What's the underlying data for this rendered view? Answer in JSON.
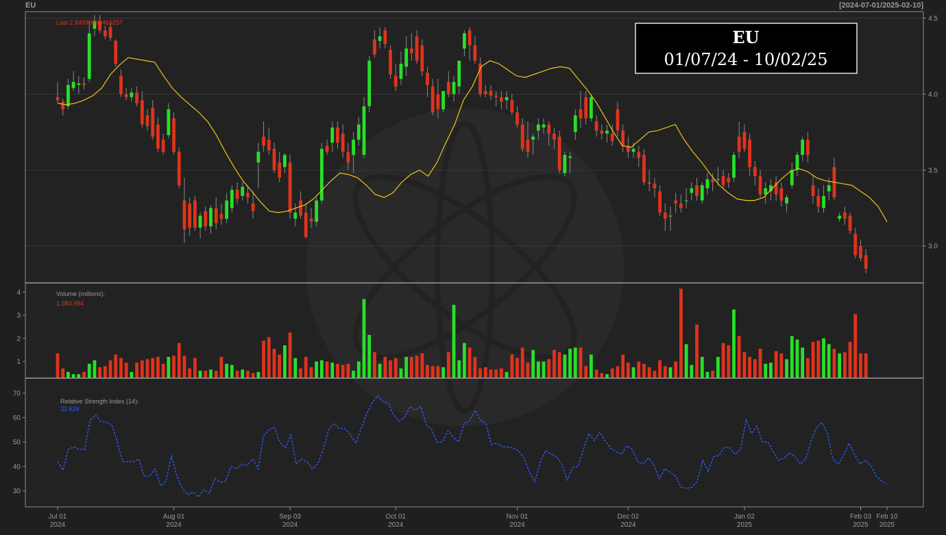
{
  "header": {
    "symbol": "EU",
    "range": "[2024-07-01/2025-02-10]"
  },
  "title_box": {
    "line1": "EU",
    "line2": "01/07/24 - 10/02/25"
  },
  "colors": {
    "background": "#222222",
    "up": "#27e027",
    "down": "#e0331c",
    "ma": "#f0c419",
    "rsi": "#2f5bff",
    "axis_text": "#9a9a9a",
    "frame": "#8c8c8c"
  },
  "chart_data": {
    "type": "candlestick",
    "price_panel": {
      "last_label": "Last 2.84999990463257",
      "ylim": [
        2.78,
        4.52
      ],
      "yticks": [
        3.0,
        3.5,
        4.0,
        4.5
      ],
      "ytick_labels": [
        "3.0",
        "3.5",
        "4.0",
        "4.5"
      ],
      "ma_line": [
        3.94,
        3.93,
        3.94,
        3.96,
        3.99,
        4.04,
        4.13,
        4.19,
        4.24,
        4.23,
        4.22,
        4.21,
        4.12,
        4.04,
        3.98,
        3.93,
        3.88,
        3.82,
        3.73,
        3.62,
        3.52,
        3.43,
        3.36,
        3.29,
        3.23,
        3.22,
        3.23,
        3.25,
        3.27,
        3.31,
        3.37,
        3.43,
        3.48,
        3.47,
        3.45,
        3.4,
        3.34,
        3.32,
        3.35,
        3.42,
        3.47,
        3.5,
        3.46,
        3.55,
        3.68,
        3.8,
        3.96,
        4.05,
        4.18,
        4.22,
        4.2,
        4.16,
        4.12,
        4.11,
        4.13,
        4.15,
        4.17,
        4.18,
        4.17,
        4.1,
        4.03,
        3.95,
        3.85,
        3.75,
        3.66,
        3.65,
        3.7,
        3.75,
        3.76,
        3.78,
        3.8,
        3.7,
        3.62,
        3.55,
        3.47,
        3.4,
        3.35,
        3.31,
        3.3,
        3.3,
        3.32,
        3.38,
        3.44,
        3.49,
        3.51,
        3.49,
        3.45,
        3.43,
        3.42,
        3.41,
        3.4,
        3.36,
        3.32,
        3.26,
        3.16
      ]
    },
    "volume_panel": {
      "label": "Volume (millions):",
      "value_label": "1.383.994",
      "ylim": [
        0.28,
        4.25
      ],
      "yticks": [
        1,
        2,
        3,
        4
      ],
      "ytick_labels": [
        "1",
        "2",
        "3",
        "4"
      ]
    },
    "rsi_panel": {
      "label": "Relative Strength Index (14):",
      "value_label": "32.626",
      "ylim": [
        24,
        75
      ],
      "yticks": [
        30,
        40,
        50,
        60,
        70
      ],
      "ytick_labels": [
        "30",
        "40",
        "50",
        "60",
        "70"
      ],
      "values": [
        42,
        38.5,
        47,
        48,
        47,
        47,
        59,
        61,
        58.5,
        58,
        57,
        50,
        42,
        42,
        42,
        43,
        36,
        36,
        39,
        32,
        34,
        44.5,
        36,
        31,
        28.5,
        29.5,
        27.5,
        30.5,
        29,
        35,
        33.5,
        34,
        40,
        39,
        41,
        40.5,
        43,
        39,
        52.5,
        55,
        56,
        50,
        47.5,
        53,
        41,
        43,
        42,
        39,
        41,
        47,
        55,
        57.5,
        55.5,
        55.5,
        53,
        49.5,
        55.5,
        61.5,
        66,
        69,
        66.5,
        66,
        61,
        58.5,
        60,
        64.5,
        63,
        64.5,
        57,
        55,
        50,
        50,
        54.5,
        52,
        50,
        57.5,
        58.5,
        63,
        59,
        57.5,
        49,
        49.5,
        48,
        48,
        47.5,
        46.5,
        43.5,
        38,
        33.5,
        41.5,
        46.5,
        45,
        44,
        41,
        34.5,
        39.5,
        40,
        47,
        53.5,
        50.5,
        54,
        50.5,
        47.5,
        46,
        45,
        48.5,
        47,
        42,
        41,
        43.5,
        40.5,
        35,
        39,
        37.5,
        36,
        31.5,
        31,
        31.5,
        34,
        42.5,
        38,
        44,
        44.5,
        48,
        47.5,
        45,
        47,
        59,
        53.5,
        56.5,
        50,
        50,
        46,
        42.5,
        43.5,
        45.5,
        44,
        41,
        43,
        50.5,
        56,
        58,
        53.5,
        43,
        41,
        44.5,
        49.5,
        45,
        41,
        42.5,
        40.5,
        36,
        34,
        32.6
      ]
    },
    "x_axis": {
      "ticks": [
        {
          "index": 0,
          "line1": "Jul 01",
          "line2": "2024"
        },
        {
          "index": 22,
          "line1": "Aug 01",
          "line2": "2024"
        },
        {
          "index": 44,
          "line1": "Sep 03",
          "line2": "2024"
        },
        {
          "index": 64,
          "line1": "Oct 01",
          "line2": "2024"
        },
        {
          "index": 87,
          "line1": "Nov 01",
          "line2": "2024"
        },
        {
          "index": 108,
          "line1": "Dec 02",
          "line2": "2024"
        },
        {
          "index": 130,
          "line1": "Jan 02",
          "line2": "2025"
        },
        {
          "index": 152,
          "line1": "Feb 03",
          "line2": "2025"
        },
        {
          "index": 157,
          "line1": "Feb 10",
          "line2": "2025"
        }
      ],
      "count": 158
    },
    "candles": [
      [
        3.98,
        4.08,
        3.94,
        3.96,
        1.35
      ],
      [
        3.95,
        3.97,
        3.86,
        3.9,
        0.7
      ],
      [
        3.92,
        4.1,
        3.9,
        4.06,
        0.55
      ],
      [
        4.04,
        4.15,
        4.02,
        4.08,
        0.45
      ],
      [
        4.06,
        4.12,
        4.0,
        4.07,
        0.45
      ],
      [
        4.07,
        4.11,
        4.03,
        4.06,
        0.55
      ],
      [
        4.1,
        4.48,
        4.08,
        4.4,
        0.9
      ],
      [
        4.43,
        4.52,
        4.38,
        4.48,
        1.05
      ],
      [
        4.48,
        4.52,
        4.4,
        4.42,
        0.75
      ],
      [
        4.42,
        4.45,
        4.36,
        4.38,
        0.8
      ],
      [
        4.44,
        4.47,
        4.35,
        4.37,
        1.05
      ],
      [
        4.35,
        4.36,
        4.18,
        4.2,
        1.3
      ],
      [
        4.12,
        4.16,
        3.98,
        4.0,
        1.15
      ],
      [
        4.0,
        4.04,
        3.96,
        3.98,
        0.95
      ],
      [
        3.98,
        4.04,
        3.95,
        4.01,
        0.55
      ],
      [
        4.01,
        4.05,
        3.92,
        3.94,
        0.95
      ],
      [
        3.96,
        4.02,
        3.78,
        3.8,
        1.05
      ],
      [
        3.86,
        3.9,
        3.76,
        3.79,
        1.1
      ],
      [
        3.91,
        3.96,
        3.7,
        3.72,
        1.15
      ],
      [
        3.8,
        3.85,
        3.62,
        3.64,
        1.2
      ],
      [
        3.7,
        3.74,
        3.6,
        3.62,
        0.9
      ],
      [
        3.73,
        3.94,
        3.71,
        3.9,
        1.2
      ],
      [
        3.84,
        3.88,
        3.6,
        3.62,
        1.25
      ],
      [
        3.62,
        3.65,
        3.38,
        3.4,
        1.8
      ],
      [
        3.3,
        3.45,
        3.02,
        3.11,
        1.25
      ],
      [
        3.28,
        3.32,
        3.07,
        3.12,
        0.7
      ],
      [
        3.3,
        3.33,
        3.1,
        3.12,
        1.15
      ],
      [
        3.12,
        3.22,
        3.05,
        3.2,
        0.6
      ],
      [
        3.23,
        3.26,
        3.1,
        3.13,
        0.6
      ],
      [
        3.13,
        3.27,
        3.08,
        3.25,
        0.65
      ],
      [
        3.25,
        3.32,
        3.11,
        3.15,
        0.6
      ],
      [
        3.21,
        3.28,
        3.14,
        3.18,
        1.2
      ],
      [
        3.18,
        3.35,
        3.15,
        3.3,
        0.9
      ],
      [
        3.25,
        3.4,
        3.22,
        3.37,
        0.85
      ],
      [
        3.37,
        3.42,
        3.28,
        3.31,
        0.6
      ],
      [
        3.33,
        3.42,
        3.3,
        3.39,
        0.65
      ],
      [
        3.35,
        3.4,
        3.28,
        3.32,
        0.6
      ],
      [
        3.28,
        3.36,
        3.18,
        3.23,
        0.5
      ],
      [
        3.55,
        3.68,
        3.38,
        3.62,
        0.55
      ],
      [
        3.72,
        3.82,
        3.62,
        3.66,
        1.9
      ],
      [
        3.7,
        3.78,
        3.6,
        3.63,
        2.05
      ],
      [
        3.64,
        3.68,
        3.48,
        3.5,
        1.55
      ],
      [
        3.55,
        3.62,
        3.42,
        3.45,
        1.3
      ],
      [
        3.52,
        3.61,
        3.48,
        3.6,
        1.7
      ],
      [
        3.55,
        3.6,
        3.18,
        3.22,
        2.25
      ],
      [
        3.18,
        3.28,
        3.13,
        3.22,
        1.15
      ],
      [
        3.3,
        3.36,
        3.18,
        3.2,
        0.7
      ],
      [
        3.22,
        3.28,
        3.05,
        3.06,
        1.2
      ],
      [
        3.18,
        3.25,
        3.12,
        3.16,
        0.75
      ],
      [
        3.16,
        3.32,
        3.13,
        3.3,
        1.0
      ],
      [
        3.3,
        3.68,
        3.28,
        3.64,
        1.05
      ],
      [
        3.66,
        3.7,
        3.6,
        3.62,
        1.0
      ],
      [
        3.68,
        3.82,
        3.62,
        3.78,
        0.95
      ],
      [
        3.78,
        3.82,
        3.64,
        3.68,
        0.9
      ],
      [
        3.74,
        3.8,
        3.58,
        3.62,
        0.85
      ],
      [
        3.62,
        3.68,
        3.5,
        3.55,
        0.9
      ],
      [
        3.6,
        3.75,
        3.48,
        3.7,
        0.6
      ],
      [
        3.7,
        3.85,
        3.66,
        3.8,
        1.0
      ],
      [
        3.6,
        3.98,
        3.58,
        3.92,
        3.7
      ],
      [
        3.92,
        4.25,
        3.88,
        4.22,
        2.15
      ],
      [
        4.36,
        4.42,
        4.24,
        4.26,
        1.4
      ],
      [
        4.35,
        4.44,
        4.3,
        4.38,
        0.9
      ],
      [
        4.42,
        4.44,
        4.3,
        4.33,
        1.2
      ],
      [
        4.29,
        4.32,
        4.1,
        4.13,
        1.05
      ],
      [
        4.12,
        4.2,
        4.02,
        4.05,
        1.15
      ],
      [
        4.1,
        4.28,
        4.06,
        4.2,
        0.7
      ],
      [
        4.18,
        4.38,
        4.12,
        4.3,
        1.2
      ],
      [
        4.3,
        4.4,
        4.22,
        4.27,
        1.2
      ],
      [
        4.38,
        4.42,
        4.2,
        4.22,
        1.25
      ],
      [
        4.32,
        4.36,
        4.12,
        4.15,
        1.35
      ],
      [
        4.14,
        4.18,
        3.98,
        4.06,
        0.85
      ],
      [
        4.05,
        4.1,
        3.86,
        3.88,
        0.8
      ],
      [
        4.0,
        4.1,
        3.84,
        3.9,
        0.8
      ],
      [
        3.9,
        4.02,
        3.88,
        4.02,
        0.75
      ],
      [
        4.08,
        4.15,
        3.98,
        4.0,
        1.4
      ],
      [
        4.0,
        4.12,
        3.95,
        4.08,
        3.45
      ],
      [
        4.05,
        4.22,
        4.0,
        4.22,
        1.05
      ],
      [
        4.3,
        4.42,
        4.25,
        4.4,
        1.8
      ],
      [
        4.42,
        4.44,
        4.22,
        4.32,
        1.6
      ],
      [
        4.32,
        4.38,
        4.2,
        4.22,
        1.2
      ],
      [
        4.2,
        4.24,
        3.98,
        4.0,
        0.7
      ],
      [
        4.02,
        4.06,
        3.98,
        4.0,
        0.75
      ],
      [
        4.02,
        4.06,
        3.96,
        3.99,
        0.65
      ],
      [
        3.99,
        4.02,
        3.92,
        3.98,
        0.65
      ],
      [
        3.98,
        4.02,
        3.9,
        3.95,
        0.7
      ],
      [
        3.96,
        4.02,
        3.9,
        3.98,
        0.55
      ],
      [
        3.96,
        4.0,
        3.86,
        3.88,
        1.3
      ],
      [
        3.88,
        3.92,
        3.78,
        3.8,
        1.15
      ],
      [
        3.8,
        3.84,
        3.62,
        3.64,
        1.6
      ],
      [
        3.7,
        3.82,
        3.58,
        3.62,
        0.95
      ],
      [
        3.7,
        3.74,
        3.6,
        3.72,
        1.5
      ],
      [
        3.76,
        3.84,
        3.7,
        3.8,
        1.0
      ],
      [
        3.78,
        3.84,
        3.74,
        3.8,
        1.0
      ],
      [
        3.8,
        3.82,
        3.66,
        3.74,
        1.1
      ],
      [
        3.74,
        3.78,
        3.64,
        3.7,
        1.5
      ],
      [
        3.72,
        3.76,
        3.48,
        3.5,
        1.4
      ],
      [
        3.48,
        3.62,
        3.46,
        3.6,
        1.3
      ],
      [
        3.58,
        3.62,
        3.48,
        3.59,
        1.55
      ],
      [
        3.75,
        3.9,
        3.7,
        3.86,
        1.6
      ],
      [
        3.9,
        4.02,
        3.78,
        3.84,
        1.6
      ],
      [
        3.98,
        4.02,
        3.8,
        3.84,
        0.8
      ],
      [
        3.84,
        4.0,
        3.82,
        3.98,
        1.3
      ],
      [
        3.82,
        3.86,
        3.72,
        3.76,
        0.65
      ],
      [
        3.76,
        3.8,
        3.7,
        3.74,
        0.5
      ],
      [
        3.74,
        3.8,
        3.68,
        3.76,
        0.45
      ],
      [
        3.74,
        3.8,
        3.66,
        3.69,
        0.7
      ],
      [
        3.9,
        3.95,
        3.72,
        3.76,
        0.8
      ],
      [
        3.76,
        3.8,
        3.62,
        3.66,
        1.3
      ],
      [
        3.66,
        3.72,
        3.58,
        3.62,
        0.95
      ],
      [
        3.62,
        3.68,
        3.58,
        3.64,
        0.75
      ],
      [
        3.62,
        3.66,
        3.52,
        3.58,
        1.0
      ],
      [
        3.6,
        3.64,
        3.4,
        3.42,
        0.9
      ],
      [
        3.42,
        3.5,
        3.36,
        3.41,
        0.75
      ],
      [
        3.41,
        3.45,
        3.32,
        3.38,
        0.6
      ],
      [
        3.36,
        3.4,
        3.2,
        3.22,
        1.05
      ],
      [
        3.22,
        3.28,
        3.1,
        3.18,
        0.8
      ],
      [
        3.2,
        3.26,
        3.1,
        3.2,
        0.75
      ],
      [
        3.3,
        3.35,
        3.22,
        3.28,
        1.0
      ],
      [
        3.28,
        3.34,
        3.22,
        3.25,
        4.15
      ],
      [
        3.3,
        3.38,
        3.25,
        3.3,
        1.75
      ],
      [
        3.35,
        3.42,
        3.3,
        3.38,
        0.85
      ],
      [
        3.4,
        3.45,
        3.3,
        3.33,
        2.6
      ],
      [
        3.3,
        3.42,
        3.28,
        3.4,
        1.2
      ],
      [
        3.38,
        3.48,
        3.34,
        3.44,
        0.55
      ],
      [
        3.44,
        3.48,
        3.36,
        3.42,
        0.6
      ],
      [
        3.44,
        3.52,
        3.4,
        3.44,
        1.2
      ],
      [
        3.46,
        3.5,
        3.38,
        3.4,
        1.8
      ],
      [
        3.45,
        3.48,
        3.38,
        3.42,
        1.7
      ],
      [
        3.45,
        3.62,
        3.42,
        3.6,
        3.25
      ],
      [
        3.72,
        3.82,
        3.58,
        3.62,
        2.1
      ],
      [
        3.75,
        3.8,
        3.62,
        3.64,
        1.4
      ],
      [
        3.7,
        3.74,
        3.46,
        3.52,
        1.2
      ],
      [
        3.52,
        3.56,
        3.4,
        3.46,
        1.1
      ],
      [
        3.46,
        3.5,
        3.32,
        3.34,
        1.55
      ],
      [
        3.34,
        3.42,
        3.28,
        3.38,
        0.9
      ],
      [
        3.36,
        3.44,
        3.3,
        3.4,
        0.95
      ],
      [
        3.42,
        3.46,
        3.3,
        3.34,
        1.45
      ],
      [
        3.38,
        3.42,
        3.26,
        3.3,
        1.35
      ],
      [
        3.28,
        3.34,
        3.22,
        3.32,
        1.1
      ],
      [
        3.4,
        3.55,
        3.38,
        3.5,
        2.1
      ],
      [
        3.5,
        3.62,
        3.46,
        3.6,
        1.95
      ],
      [
        3.6,
        3.72,
        3.56,
        3.7,
        1.6
      ],
      [
        3.7,
        3.75,
        3.55,
        3.6,
        1.15
      ],
      [
        3.4,
        3.46,
        3.28,
        3.33,
        1.85
      ],
      [
        3.33,
        3.38,
        3.22,
        3.26,
        1.9
      ],
      [
        3.25,
        3.4,
        3.22,
        3.33,
        2.0
      ],
      [
        3.36,
        3.45,
        3.3,
        3.4,
        1.75
      ],
      [
        3.52,
        3.58,
        3.3,
        3.32,
        1.55
      ],
      [
        3.18,
        3.22,
        3.16,
        3.2,
        1.35
      ],
      [
        3.22,
        3.26,
        3.14,
        3.18,
        1.4
      ],
      [
        3.2,
        3.22,
        3.08,
        3.1,
        1.85
      ],
      [
        3.08,
        3.12,
        2.92,
        2.94,
        3.05
      ],
      [
        3.0,
        3.04,
        2.9,
        2.92,
        1.35
      ],
      [
        2.94,
        2.98,
        2.82,
        2.85,
        1.35
      ]
    ]
  }
}
